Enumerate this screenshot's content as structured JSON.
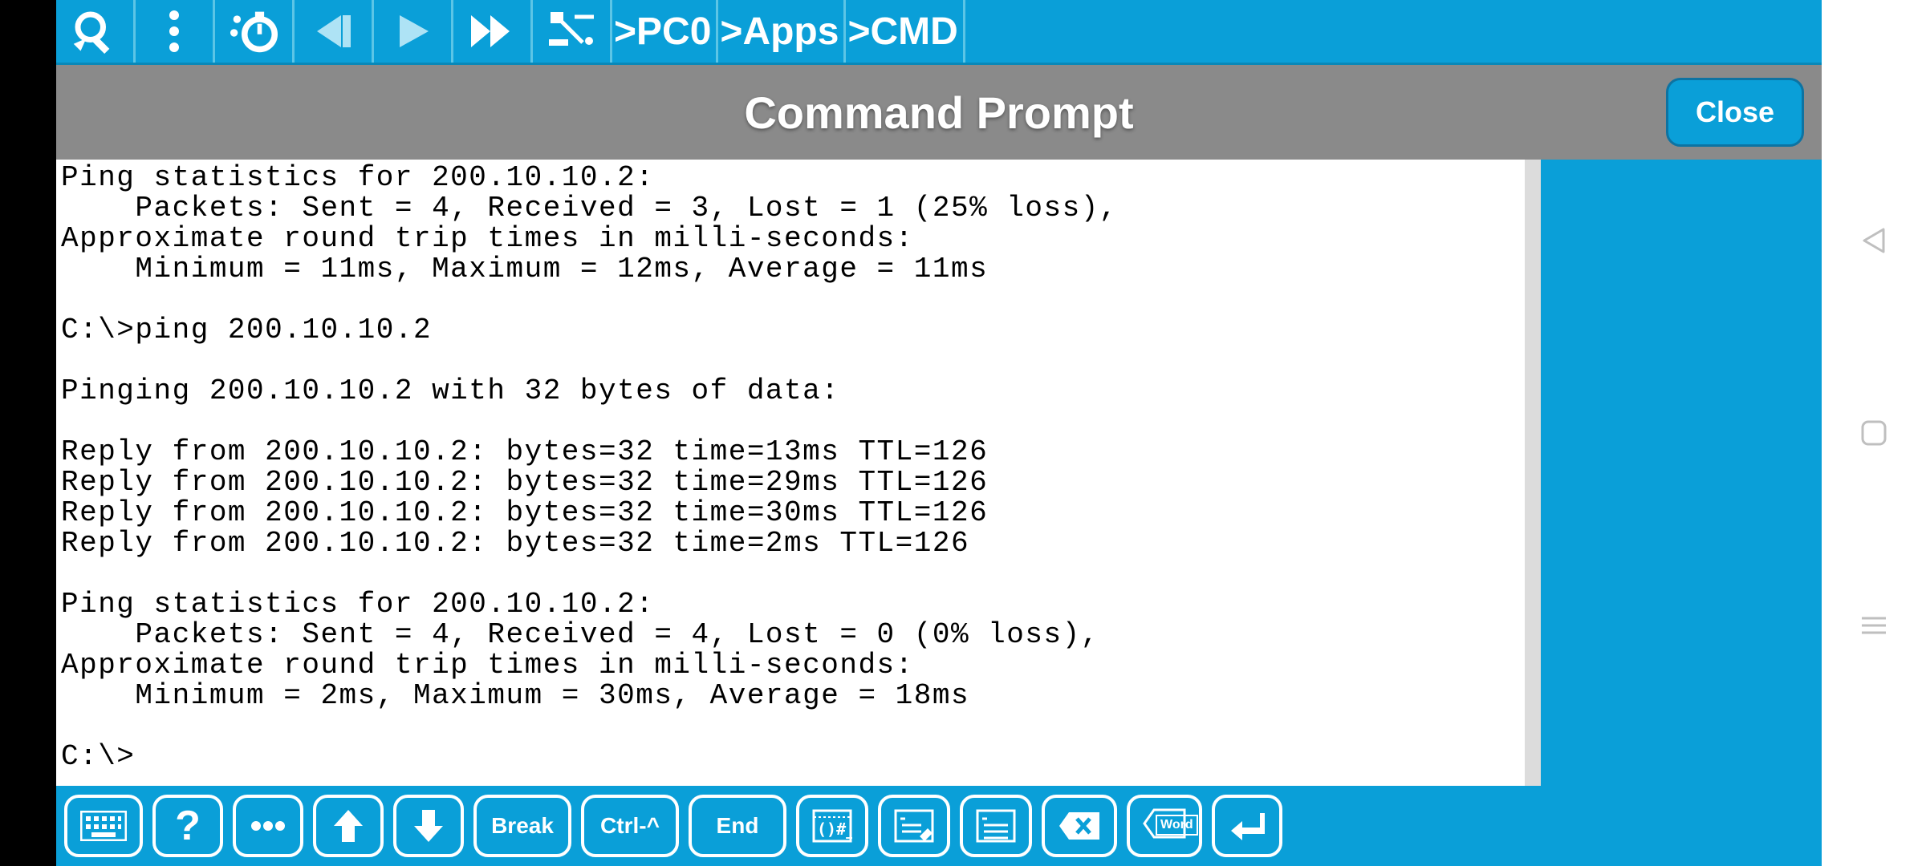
{
  "breadcrumb": {
    "seg1": ">PC0",
    "seg2": ">Apps",
    "seg3": ">CMD"
  },
  "header": {
    "title": "Command Prompt",
    "close_label": "Close"
  },
  "terminal": {
    "text": "Ping statistics for 200.10.10.2:\n    Packets: Sent = 4, Received = 3, Lost = 1 (25% loss),\nApproximate round trip times in milli-seconds:\n    Minimum = 11ms, Maximum = 12ms, Average = 11ms\n\nC:\\>ping 200.10.10.2\n\nPinging 200.10.10.2 with 32 bytes of data:\n\nReply from 200.10.10.2: bytes=32 time=13ms TTL=126\nReply from 200.10.10.2: bytes=32 time=29ms TTL=126\nReply from 200.10.10.2: bytes=32 time=30ms TTL=126\nReply from 200.10.10.2: bytes=32 time=2ms TTL=126\n\nPing statistics for 200.10.10.2:\n    Packets: Sent = 4, Received = 4, Lost = 0 (0% loss),\nApproximate round trip times in milli-seconds:\n    Minimum = 2ms, Maximum = 30ms, Average = 18ms\n\nC:\\>"
  },
  "bottom": {
    "break": "Break",
    "ctrl": "Ctrl-^",
    "end": "End",
    "word": "Word"
  },
  "icons": {
    "search": "search-icon",
    "more_v": "more-vertical-icon",
    "clock": "timer-icon",
    "step_back": "step-back-icon",
    "play": "play-icon",
    "fast_forward": "fast-forward-icon",
    "topology": "topology-icon",
    "keyboard": "keyboard-icon",
    "help": "question-icon",
    "ellipsis": "ellipsis-icon",
    "up": "arrow-up-icon",
    "down": "arrow-down-icon",
    "var": "variables-icon",
    "script": "script-edit-icon",
    "list": "script-list-icon",
    "backspace": "backspace-icon",
    "enter": "enter-icon",
    "android_back": "android-back-icon",
    "android_home": "android-home-icon",
    "android_recent": "android-recent-icon"
  }
}
